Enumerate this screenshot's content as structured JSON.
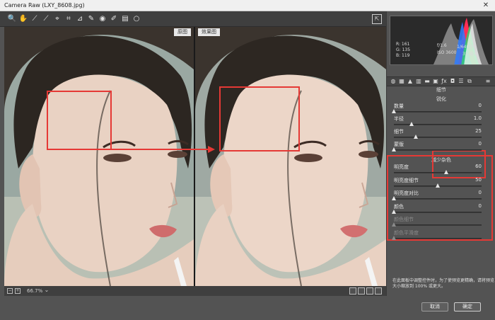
{
  "window": {
    "title": "Camera Raw (LXY_8608.jpg)",
    "close": "✕"
  },
  "toolbar": {
    "tools": [
      {
        "name": "zoom-tool-icon",
        "glyph": "🔍"
      },
      {
        "name": "hand-tool-icon",
        "glyph": "✋"
      },
      {
        "name": "white-balance-tool-icon",
        "glyph": "⟋"
      },
      {
        "name": "color-sampler-tool-icon",
        "glyph": "⟋"
      },
      {
        "name": "targeted-adjustment-tool-icon",
        "glyph": "⌖"
      },
      {
        "name": "crop-tool-icon",
        "glyph": "⌗"
      },
      {
        "name": "straighten-tool-icon",
        "glyph": "⊿"
      },
      {
        "name": "spot-removal-tool-icon",
        "glyph": "✎"
      },
      {
        "name": "red-eye-tool-icon",
        "glyph": "◉"
      },
      {
        "name": "adjustment-brush-tool-icon",
        "glyph": "✐"
      },
      {
        "name": "graduated-filter-tool-icon",
        "glyph": "▤"
      },
      {
        "name": "radial-filter-tool-icon",
        "glyph": "○"
      }
    ],
    "export_glyph": "⇱"
  },
  "view": {
    "before_label": "原图",
    "after_label": "效果图"
  },
  "status": {
    "zoom": "66.7%",
    "minus": "−",
    "plus": "+",
    "dropdown": "⌄"
  },
  "histogram": {
    "r": "R:  161",
    "g": "G:  135",
    "b": "B:  119",
    "aperture": "f/1.6",
    "shutter": "1/640 秒",
    "iso": "ISO 3600",
    "focal": "35 毫米"
  },
  "panel": {
    "title": "细节",
    "sharpen": {
      "heading": "锐化",
      "sliders": [
        {
          "label": "数量",
          "value": "0",
          "pos": 0.0
        },
        {
          "label": "半径",
          "value": "1.0",
          "pos": 0.2
        },
        {
          "label": "细节",
          "value": "25",
          "pos": 0.25
        },
        {
          "label": "蒙版",
          "value": "0",
          "pos": 0.0
        }
      ]
    },
    "noise": {
      "heading": "减少杂色",
      "sliders": [
        {
          "label": "明亮度",
          "value": "60",
          "pos": 0.6,
          "disabled": false
        },
        {
          "label": "明亮度细节",
          "value": "50",
          "pos": 0.5,
          "disabled": false
        },
        {
          "label": "明亮度对比",
          "value": "0",
          "pos": 0.0,
          "disabled": false
        },
        {
          "label": "颜色",
          "value": "0",
          "pos": 0.0,
          "disabled": false
        },
        {
          "label": "颜色细节",
          "value": "",
          "pos": 0.0,
          "disabled": true
        },
        {
          "label": "颜色平滑度",
          "value": "",
          "pos": 0.0,
          "disabled": true
        }
      ]
    },
    "hint": "在此面板中调整控件时，为了使预览更精确，请将预览大小缩放到 100% 或更大。"
  },
  "buttons": {
    "cancel": "取消",
    "ok": "确定"
  },
  "colors": {
    "accent_red": "#e53935"
  }
}
